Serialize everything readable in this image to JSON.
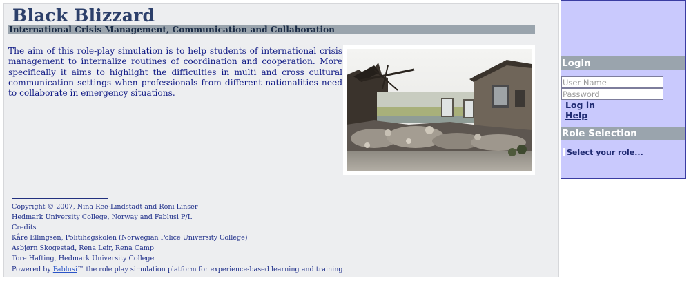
{
  "site": {
    "title": "Black Blizzard",
    "subtitle": "International Crisis Management, Communication and Collaboration"
  },
  "intro": {
    "text": "The aim of this role-play simulation is to help students of international crisis management to internalize routines of coordination and cooperation. More specifically it aims to highlight the difficulties in multi and cross cultural communication settings when professionals from different nationalities need to collaborate in emergency situations."
  },
  "footer": {
    "copyright": "Copyright © 2007, Nina Ree-Lindstadt and Roni Linser",
    "institutions": "Hedmark University College, Norway and Fablusi P/L",
    "credits_heading": "Credits",
    "credit_1": "Kåre Ellingsen, Politihøgskolen (Norwegian Police University College)",
    "credit_2": "Asbjørn Skogestad, Rena Leir, Rena Camp",
    "credit_3": "Tore Hafting, Hedmark University College",
    "powered_prefix": "Powered by ",
    "powered_link": "Fablusi",
    "powered_suffix": "™ the role play simulation platform for experience-based learning and training."
  },
  "sidebar": {
    "login_header": "Login",
    "username_placeholder": "User Name",
    "password_placeholder": "Password",
    "login_link": "Log in",
    "help_link": "Help",
    "role_header": "Role Selection",
    "role_link": "Select your role..."
  },
  "colors": {
    "title": "#2c3f6a",
    "header_bar": "#9aa4ad",
    "body_text": "#101a85",
    "sidebar_bg": "#c9c9fd",
    "link": "#2a54c7"
  }
}
